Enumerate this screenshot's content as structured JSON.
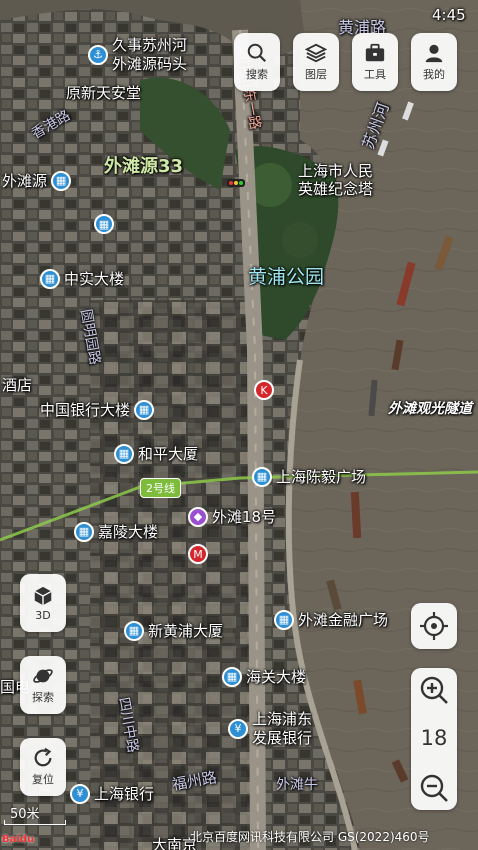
{
  "status": {
    "time": "4:45"
  },
  "toolbar": {
    "search": "搜索",
    "layers": "图层",
    "tools": "工具",
    "mine": "我的"
  },
  "side": {
    "mode3d": "3D",
    "explore": "探索",
    "reset": "复位"
  },
  "zoom": {
    "level": "18"
  },
  "scale": {
    "label": "50米"
  },
  "copyright": "北京百度网讯科技有限公司 GS(2022)460号",
  "logo": "Baidu",
  "map_labels": {
    "area_bund33": "外滩源33",
    "huangpu_park": "黄浦公园",
    "monument": "上海市人民\n英雄纪念塔",
    "suzhou_creek": "苏州河",
    "huangpu_road": "黄浦路",
    "zhongshan_road": "中山东一路",
    "yuanmingyuan_road": "圆明园路",
    "xianggang_road": "香港路",
    "sichuan_road": "四川中路",
    "fuzhou_road": "福州路",
    "bund_tunnel": "外滩观光隧道",
    "bund_cow": "外滩牛",
    "hotel_edge": "酒店",
    "dian_edge": "国电",
    "dananjing": "大南京"
  },
  "pois": {
    "jiushi": "久事苏州河\n外滩源码头",
    "yuanxintian": "原新天安堂",
    "waitanyuan": "外滩源",
    "zhongshi": "中实大楼",
    "bank_china": "中国银行大楼",
    "heping": "和平大厦",
    "chenyi": "上海陈毅广场",
    "bund18": "外滩18号",
    "jialing": "嘉陵大楼",
    "xinhuangpu": "新黄浦大厦",
    "financial": "外滩金融广场",
    "customs": "海关大楼",
    "spd": "上海浦东\n发展银行",
    "shanghai_bank": "上海银行"
  },
  "metro_line": "2号线",
  "colors": {
    "river": "#6b655a",
    "green": "#2f4a2a",
    "metro": "#7dbb3a",
    "poi_blue": "#2e8fd4"
  }
}
